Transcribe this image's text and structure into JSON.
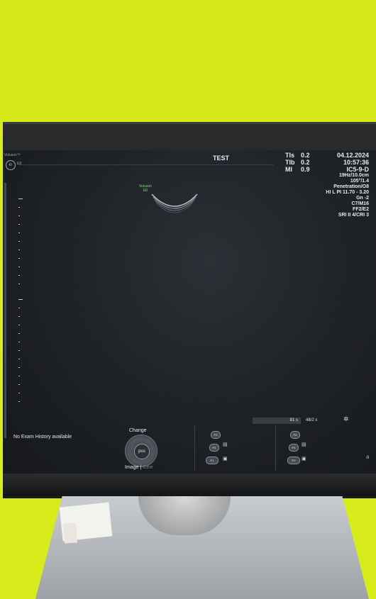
{
  "screen": {
    "brand": "Voluson™",
    "model": "E8",
    "title": "TEST",
    "params_left": [
      {
        "label": "TIs",
        "value": "0.2"
      },
      {
        "label": "TIb",
        "value": "0.2"
      },
      {
        "label": "MI",
        "value": "0.9"
      }
    ],
    "date": "04.12.2024",
    "time": "10:57:36",
    "probe": "IC5-9-D",
    "settings": [
      "19Hz/10.0cm",
      "105°/1.4",
      "Penetration/O8",
      "HI L PI 11.70 - 3.20",
      "Gn -2",
      "C7/M16",
      "FF2/E2",
      "SRI II 4/CRI 3"
    ],
    "probe_label": {
      "brand": "Voluson",
      "model": "E8"
    },
    "no_exam": "No Exam History available",
    "change_label": "Change",
    "knob_label": "pos",
    "image_label": "Image",
    "separator": " | ",
    "cine_label": "Cine",
    "cine_time1": "81 s",
    "cine_time2": "48/2 s",
    "presets_a": [
      "P3",
      "P2",
      "P1"
    ],
    "presets_b": [
      "P6",
      "P4",
      "P2"
    ],
    "corner_letter": "a"
  }
}
